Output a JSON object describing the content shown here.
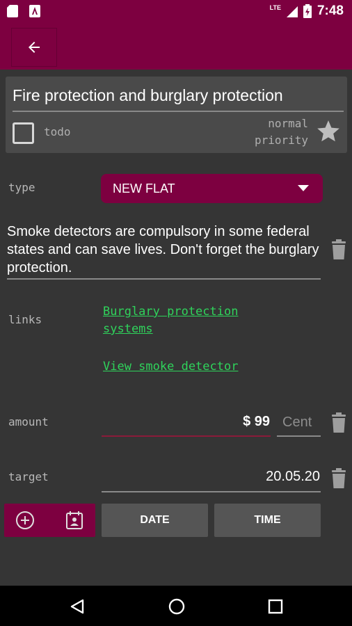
{
  "status_bar": {
    "time": "7:48",
    "network": "LTE"
  },
  "app_bar": {
    "back_icon": "arrow-back-icon"
  },
  "item": {
    "title": "Fire protection and burglary protection",
    "todo_label": "todo",
    "priority_line1": "normal",
    "priority_line2": "priority",
    "star_icon": "star-icon"
  },
  "type": {
    "label": "type",
    "value": "NEW FLAT"
  },
  "description": "Smoke detectors are compulsory in some federal states and can save lives. Don't forget the burglary protection.",
  "links": {
    "label": "links",
    "items": [
      "Burglary protection systems",
      "View smoke detector"
    ]
  },
  "amount": {
    "label": "amount",
    "value": "$ 99",
    "cent_placeholder": "Cent"
  },
  "target": {
    "label": "target",
    "value": "20.05.20"
  },
  "actions": {
    "date_label": "DATE",
    "time_label": "TIME"
  },
  "colors": {
    "accent": "#7d0040",
    "background": "#353535",
    "link": "#2fd35b"
  }
}
